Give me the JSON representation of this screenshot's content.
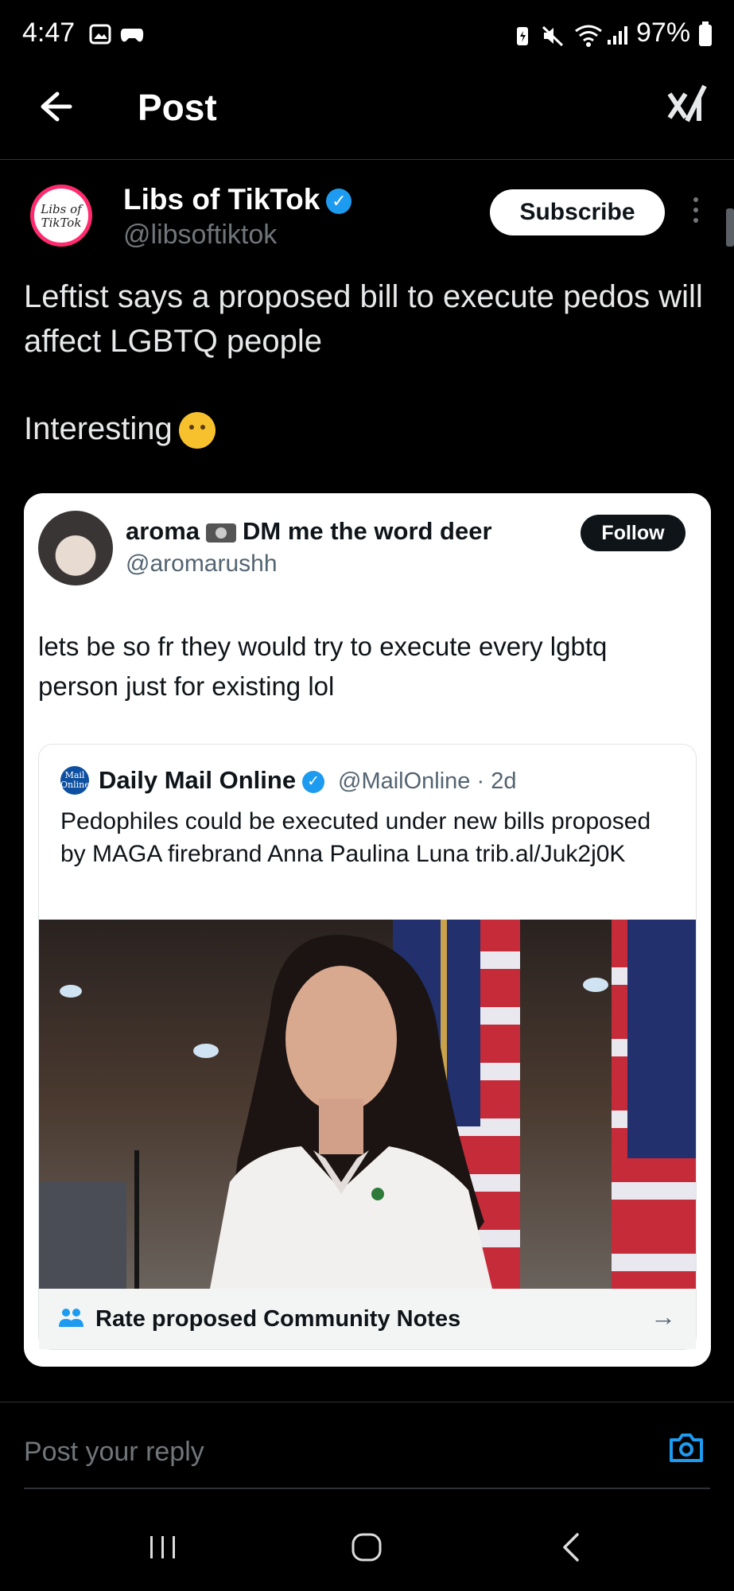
{
  "status_bar": {
    "time": "4:47",
    "battery": "97%",
    "left_icons": [
      "image-icon",
      "game-controller-icon"
    ],
    "right_icons": [
      "battery-saver-icon",
      "mute-icon",
      "wifi-icon",
      "signal-icon"
    ]
  },
  "header": {
    "title": "Post",
    "back_icon": "arrow-left-icon",
    "logo_icon": "xai-logo-icon"
  },
  "post": {
    "author": {
      "name": "Libs of TikTok",
      "handle": "@libsoftiktok",
      "verified": true,
      "avatar_text": "Libs of TikTok"
    },
    "subscribe_label": "Subscribe",
    "text_line": "Leftist says a proposed bill to execute pedos will affect LGBTQ people",
    "text_line2": "Interesting",
    "emoji": "thinking-face"
  },
  "quoted_post": {
    "author_name_a": "aroma",
    "author_name_b": "DM me the word deer",
    "handle": "@aromarushh",
    "follow_label": "Follow",
    "text": "lets be so fr they would try to execute every lgbtq person just for existing lol",
    "inner": {
      "logo_text": "Mail Online",
      "name": "Daily Mail Online",
      "verified": true,
      "meta": "@MailOnline · 2d",
      "text": "Pedophiles could be executed under new bills proposed by MAGA firebrand Anna Paulina Luna trib.al/Juk2j0K"
    },
    "community_notes_label": "Rate proposed Community Notes"
  },
  "reply": {
    "placeholder": "Post your reply"
  },
  "colors": {
    "background": "#000000",
    "accent": "#1d9bf0",
    "muted_text": "#71767b"
  }
}
